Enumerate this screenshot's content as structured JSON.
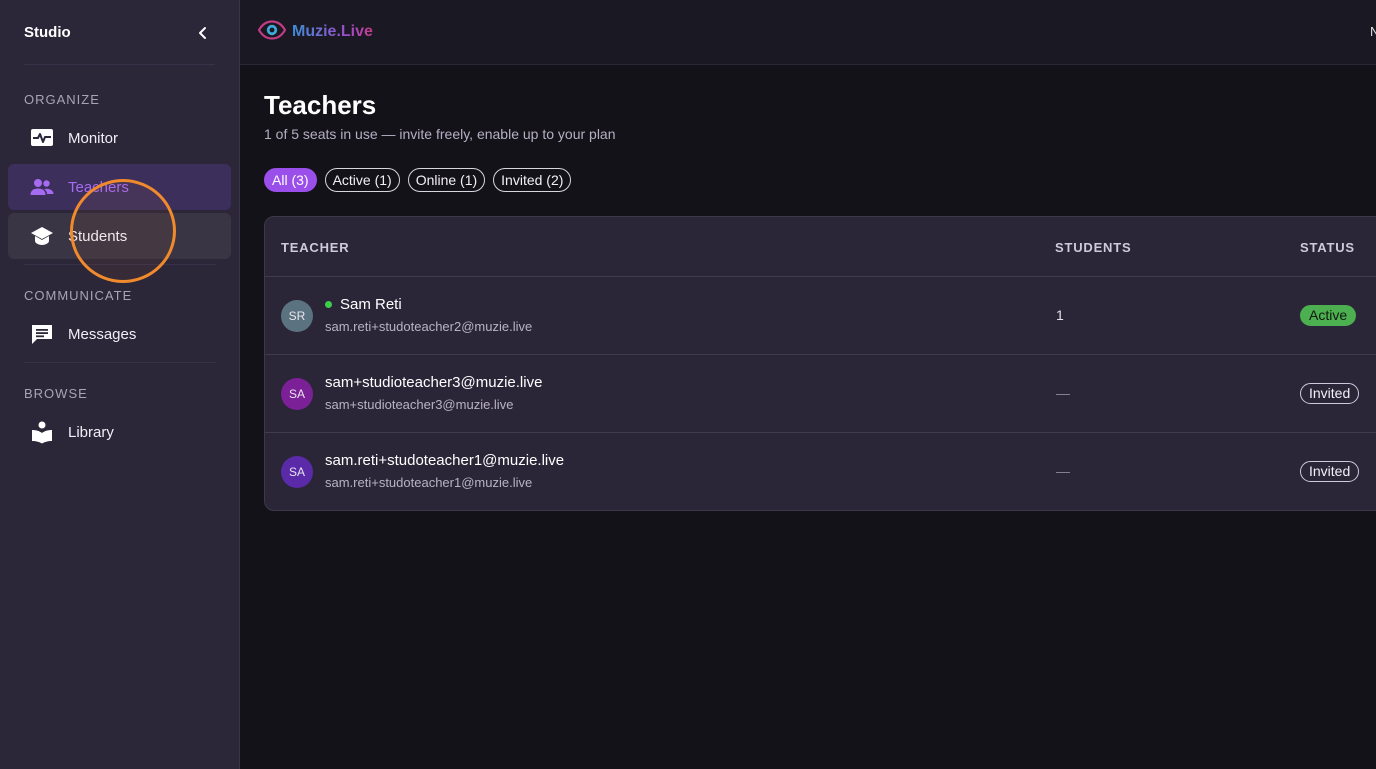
{
  "sidebar": {
    "title": "Studio",
    "collapse_icon": "chevron-left-icon",
    "sections": [
      {
        "label": "ORGANIZE"
      },
      {
        "label": "COMMUNICATE"
      },
      {
        "label": "BROWSE"
      }
    ],
    "items": [
      {
        "label": "Monitor",
        "icon": "monitor-heartbeat-icon",
        "state": "normal"
      },
      {
        "label": "Teachers",
        "icon": "people-icon",
        "state": "selected"
      },
      {
        "label": "Students",
        "icon": "graduation-cap-icon",
        "state": "hover"
      },
      {
        "label": "Messages",
        "icon": "chat-icon",
        "state": "normal"
      },
      {
        "label": "Library",
        "icon": "book-reader-icon",
        "state": "normal"
      }
    ]
  },
  "topbar": {
    "brand": "Muzie.Live",
    "brand_icon": "eye-logo-icon",
    "right_glyph": "N"
  },
  "page": {
    "title": "Teachers",
    "subtitle": "1 of 5 seats in use — invite freely, enable up to your plan",
    "filters": [
      {
        "label": "All (3)",
        "active": true
      },
      {
        "label": "Active (1)",
        "active": false
      },
      {
        "label": "Online (1)",
        "active": false
      },
      {
        "label": "Invited (2)",
        "active": false
      }
    ]
  },
  "table": {
    "headers": {
      "teacher": "TEACHER",
      "students": "STUDENTS",
      "status": "STATUS"
    },
    "rows": [
      {
        "initials": "SR",
        "avatar_color": "#5b7280",
        "name": "Sam Reti",
        "online": true,
        "email": "sam.reti+studoteacher2@muzie.live",
        "students": "1",
        "status": "Active"
      },
      {
        "initials": "SA",
        "avatar_color": "#7b2096",
        "name": "sam+studioteacher3@muzie.live",
        "online": false,
        "email": "sam+studioteacher3@muzie.live",
        "students": "—",
        "status": "Invited"
      },
      {
        "initials": "SA",
        "avatar_color": "#5a2aa8",
        "name": "sam.reti+studoteacher1@muzie.live",
        "online": false,
        "email": "sam.reti+studoteacher1@muzie.live",
        "students": "—",
        "status": "Invited"
      }
    ]
  },
  "colors": {
    "accent": "#9b4fea",
    "active_status": "#4caf50",
    "cursor_highlight": "#f08a2c"
  }
}
